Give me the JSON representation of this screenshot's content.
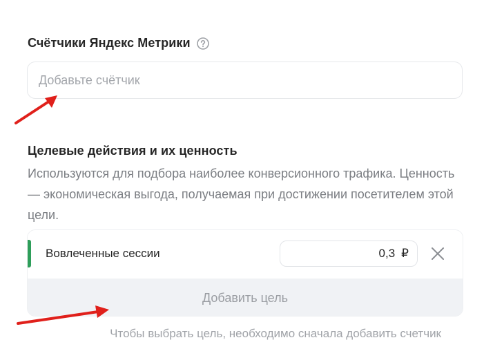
{
  "metrika": {
    "title": "Счётчики Яндекс Метрики",
    "help_icon": "question-circle-icon",
    "counter_placeholder": "Добавьте счётчик",
    "counter_value": ""
  },
  "goals": {
    "title": "Целевые действия и их ценность",
    "description": "Используются для подбора наиболее конверсионного трафика. Ценность — экономическая выгода, получаемая при достижении посетителем этой цели.",
    "items": [
      {
        "name": "Вовлеченные сессии",
        "value": "0,3",
        "currency": "₽",
        "accent_color": "#2e9e5a",
        "remove_icon": "close-icon"
      }
    ],
    "add_button_label": "Добавить цель",
    "hint": "Чтобы выбрать цель, необходимо сначала добавить счетчик"
  },
  "annotations": {
    "arrow_color": "#e0201b"
  }
}
